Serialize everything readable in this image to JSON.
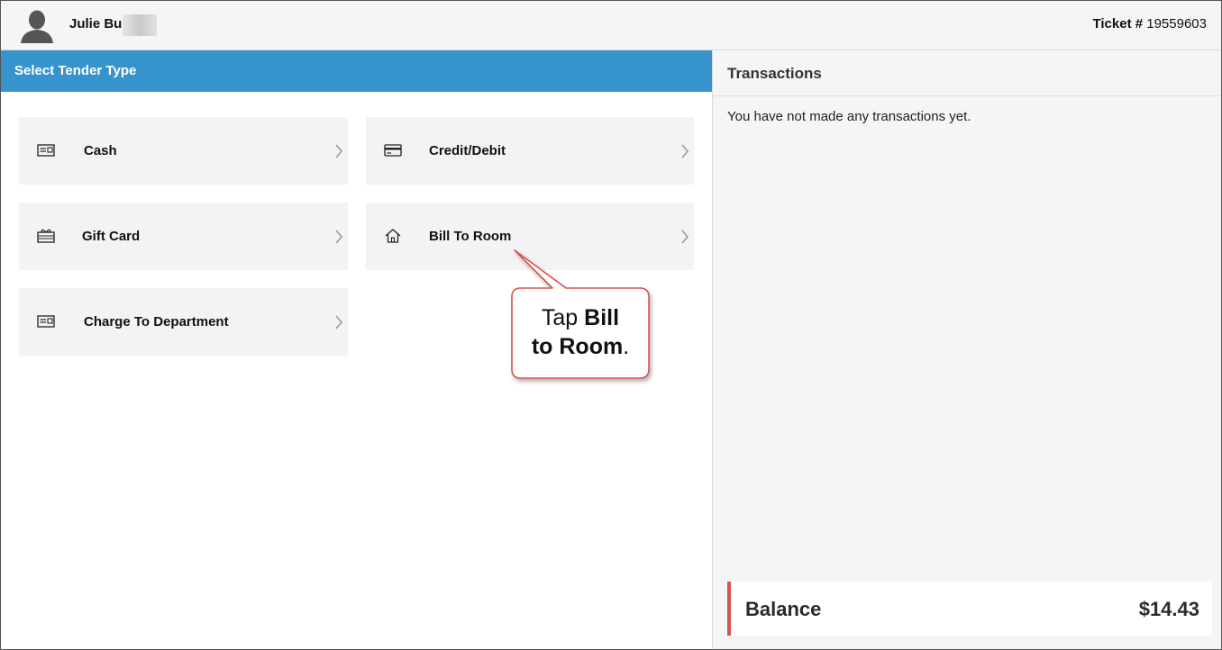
{
  "header": {
    "user_name": "Julie Bu",
    "ticket_label": "Ticket #",
    "ticket_number": "19559603"
  },
  "tender": {
    "title": "Select Tender Type",
    "options": [
      {
        "label": "Cash",
        "icon": "cash-icon"
      },
      {
        "label": "Credit/Debit",
        "icon": "credit-card-icon"
      },
      {
        "label": "Gift Card",
        "icon": "gift-card-icon"
      },
      {
        "label": "Bill To Room",
        "icon": "home-icon"
      },
      {
        "label": "Charge To Department",
        "icon": "cash-icon"
      }
    ]
  },
  "transactions": {
    "title": "Transactions",
    "empty_message": "You have not made any transactions yet.",
    "balance_label": "Balance",
    "balance_value": "$14.43"
  },
  "callout": {
    "prefix": "Tap ",
    "bold1": "Bill",
    "bold2": "to Room",
    "suffix": "."
  },
  "colors": {
    "header_bar": "#3793cc",
    "balance_accent": "#d9534f",
    "callout_border": "#d9534f"
  }
}
